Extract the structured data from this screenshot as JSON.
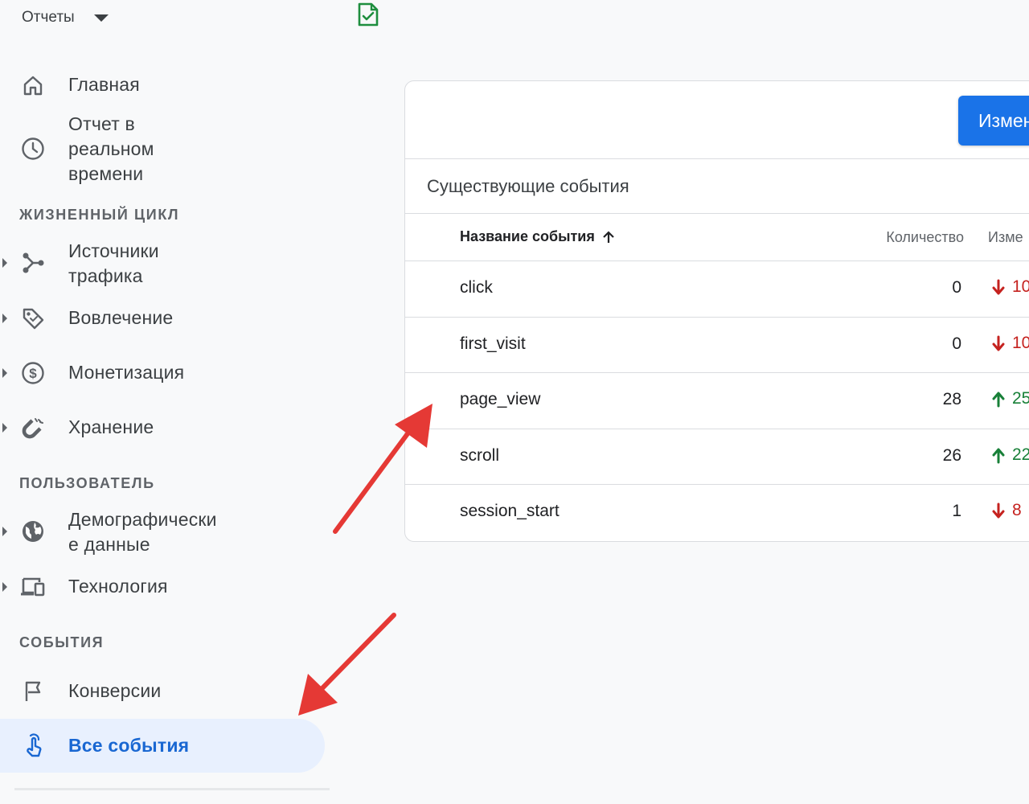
{
  "header": {
    "reports_label": "Отчеты"
  },
  "sidebar": {
    "home": "Главная",
    "realtime": [
      "Отчет в",
      "реальном",
      "времени"
    ],
    "section_lifecycle": "ЖИЗНЕННЫЙ ЦИКЛ",
    "traffic": [
      "Источники",
      "трафика"
    ],
    "engagement": "Вовлечение",
    "monetization": "Монетизация",
    "retention": "Хранение",
    "section_user": "ПОЛЬЗОВАТЕЛЬ",
    "demographics": [
      "Демографически",
      "е данные"
    ],
    "tech": "Технология",
    "section_events": "СОБЫТИЯ",
    "conversions": "Конверсии",
    "all_events": "Все события"
  },
  "card": {
    "edit_button": "Измен",
    "title": "Существующие события",
    "columns": {
      "name": "Название события",
      "count": "Количество",
      "change": "Изме"
    },
    "rows": [
      {
        "name": "click",
        "count": "0",
        "change": "10",
        "trend": "down"
      },
      {
        "name": "first_visit",
        "count": "0",
        "change": "10",
        "trend": "down"
      },
      {
        "name": "page_view",
        "count": "28",
        "change": "25",
        "trend": "up"
      },
      {
        "name": "scroll",
        "count": "26",
        "change": "22",
        "trend": "up"
      },
      {
        "name": "session_start",
        "count": "1",
        "change": "8",
        "trend": "down"
      }
    ]
  },
  "colors": {
    "accent": "#1a73e8",
    "active_bg": "#e8f0fe",
    "down": "#c5221f",
    "up": "#188038",
    "annotation_arrow": "#e53935",
    "doc_icon": "#1e8e3e"
  }
}
